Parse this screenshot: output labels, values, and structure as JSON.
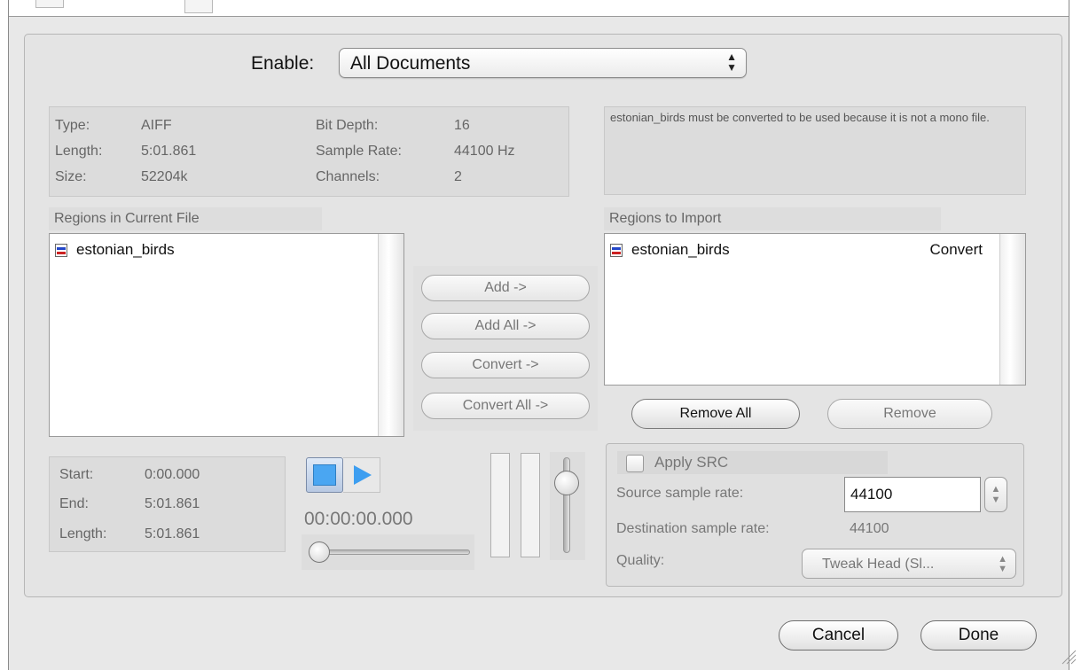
{
  "enable": {
    "label": "Enable:",
    "selected": "All Documents"
  },
  "file_info": {
    "type_label": "Type:",
    "type_value": "AIFF",
    "length_label": "Length:",
    "length_value": "5:01.861",
    "size_label": "Size:",
    "size_value": "52204k",
    "bit_depth_label": "Bit Depth:",
    "bit_depth_value": "16",
    "sample_rate_label": "Sample Rate:",
    "sample_rate_value": "44100 Hz",
    "channels_label": "Channels:",
    "channels_value": "2"
  },
  "message": "estonian_birds must be converted to be used because it is not a mono file.",
  "current_file": {
    "title": "Regions in Current File",
    "items": [
      {
        "name": "estonian_birds"
      }
    ]
  },
  "import": {
    "title": "Regions to Import",
    "items": [
      {
        "name": "estonian_birds",
        "action": "Convert"
      }
    ]
  },
  "actions": {
    "add": "Add ->",
    "add_all": "Add All ->",
    "convert": "Convert ->",
    "convert_all": "Convert All ->",
    "remove_all": "Remove All",
    "remove": "Remove"
  },
  "region_time": {
    "start_label": "Start:",
    "start_value": "0:00.000",
    "end_label": "End:",
    "end_value": "5:01.861",
    "length_label": "Length:",
    "length_value": "5:01.861"
  },
  "transport": {
    "timecode": "00:00:00.000",
    "position_fraction": 0.0,
    "volume_fraction": 0.8
  },
  "src": {
    "apply_label": "Apply SRC",
    "apply_checked": false,
    "source_rate_label": "Source sample rate:",
    "source_rate_value": "44100",
    "dest_rate_label": "Destination sample rate:",
    "dest_rate_value": "44100",
    "quality_label": "Quality:",
    "quality_value": "Tweak Head (Sl..."
  },
  "buttons": {
    "cancel": "Cancel",
    "done": "Done"
  },
  "colors": {
    "accent": "#4aa6f2",
    "window_bg": "#e8e8e8"
  }
}
